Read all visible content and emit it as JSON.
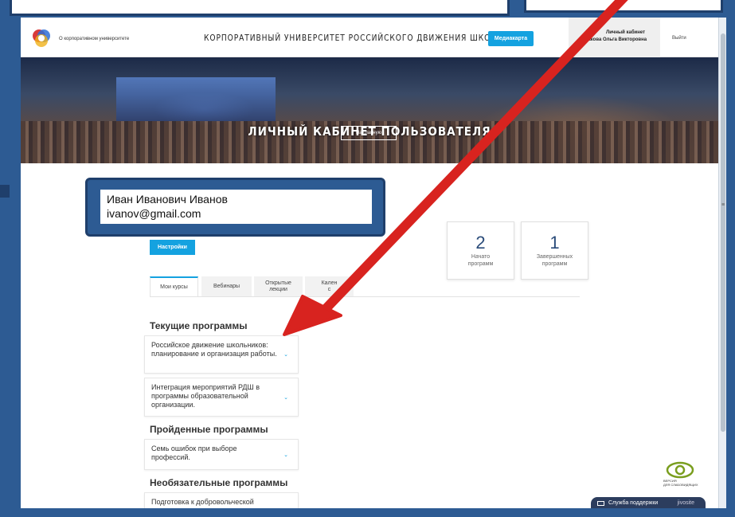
{
  "bookmarks": [
    "",
    "",
    "",
    "",
    "",
    ""
  ],
  "header": {
    "about_link": "О корпоративном университете",
    "site_title": "КОРПОРАТИВНЫЙ УНИВЕРСИТЕТ РОССИЙСКОГО ДВИЖЕНИЯ ШКОЛЬНИКОВ",
    "media_button": "Медиакарта",
    "cabinet_line1": "Личный кабинет",
    "cabinet_line2": "Сакова Ольга Викторовна",
    "logout": "Выйти"
  },
  "hero": {
    "title": "ЛИЧНЫЙ КАБИНЕТ ПОЛЬЗОВАТЕЛЯ",
    "button": "На главную"
  },
  "user": {
    "name": "Иван Иванович Иванов",
    "email": "ivanov@gmail.com"
  },
  "stats": [
    {
      "value": "2",
      "label1": "Начато",
      "label2": "программ"
    },
    {
      "value": "1",
      "label1": "Завершенных",
      "label2": "программ"
    }
  ],
  "settings_button": "Настройки",
  "tabs": [
    {
      "label1": "Мои курсы",
      "label2": ""
    },
    {
      "label1": "Вебинары",
      "label2": ""
    },
    {
      "label1": "Открытые",
      "label2": "лекции"
    },
    {
      "label1": "Кален",
      "label2": "с"
    }
  ],
  "sections": {
    "current": "Текущие программы",
    "completed": "Пройденные программы",
    "optional": "Необязательные программы"
  },
  "courses": {
    "current": [
      "Российское движение школьников: планирование и организация работы.",
      "Интеграция мероприятий РДШ в программы образовательной организации."
    ],
    "completed": [
      "Семь ошибок при выборе профессий."
    ],
    "optional": [
      "Подготовка к добровольческой"
    ]
  },
  "accessibility": {
    "label1": "ВЕРСИЯ",
    "label2": "ДЛЯ СЛАБОВИДЯЩИХ"
  },
  "support": {
    "label": "Служба поддержки",
    "brand": "jivosite"
  },
  "colors": {
    "frame": "#2d5b93",
    "accent": "#14a2e0",
    "arrow": "#d8231f"
  }
}
